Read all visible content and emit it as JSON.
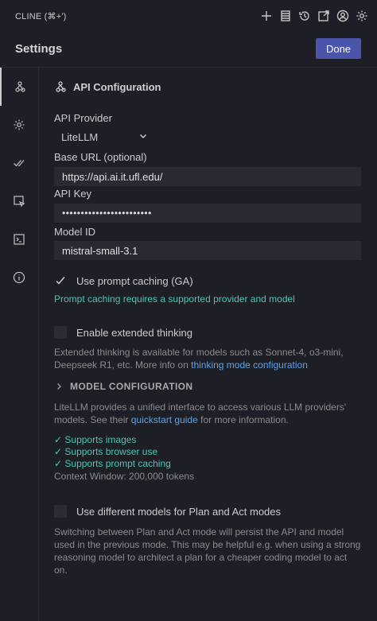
{
  "window": {
    "title": "CLINE (⌘+')"
  },
  "toolbar_icons": [
    "plus-icon",
    "database-icon",
    "history-icon",
    "external-link-icon",
    "account-icon",
    "gear-icon"
  ],
  "header": {
    "title": "Settings",
    "done_label": "Done"
  },
  "sidebar": {
    "items": [
      "api-config-icon",
      "gear-icon",
      "check-all-icon",
      "browser-icon",
      "terminal-icon",
      "info-icon"
    ],
    "active": 0
  },
  "api": {
    "section_title": "API Configuration",
    "provider_label": "API Provider",
    "provider_value": "LiteLLM",
    "base_url_label": "Base URL (optional)",
    "base_url_value": "https://api.ai.it.ufl.edu/",
    "api_key_label": "API Key",
    "api_key_value": "••••••••••••••••••••••••",
    "model_id_label": "Model ID",
    "model_id_value": "mistral-small-3.1",
    "prompt_caching_label": "Use prompt caching (GA)",
    "prompt_caching_checked": true,
    "prompt_caching_note": "Prompt caching requires a supported provider and model",
    "extended_thinking_label": "Enable extended thinking",
    "extended_thinking_checked": false,
    "extended_thinking_desc": "Extended thinking is available for models such as Sonnet-4, o3-mini, Deepseek R1, etc. More info on",
    "extended_thinking_link": "thinking mode configuration",
    "model_config_title": "MODEL CONFIGURATION",
    "litellm_desc": "LiteLLM provides a unified interface to access various LLM providers' models. See their",
    "litellm_link": "quickstart guide",
    "litellm_desc_end": "for more information.",
    "supports": [
      "✓ Supports images",
      "✓ Supports browser use",
      "✓ Supports prompt caching"
    ],
    "context_window": "Context Window: 200,000 tokens",
    "plan_act_label": "Use different models for Plan and Act modes",
    "plan_act_checked": false,
    "plan_act_desc": "Switching between Plan and Act mode will persist the API and model used in the previous mode. This may be helpful e.g. when using a strong reasoning model to architect a plan for a cheaper coding model to act on."
  },
  "colors": {
    "accent": "#4a54a8",
    "link": "#5fa0e6",
    "teal": "#4ec3b3",
    "background": "#1e1f26"
  }
}
